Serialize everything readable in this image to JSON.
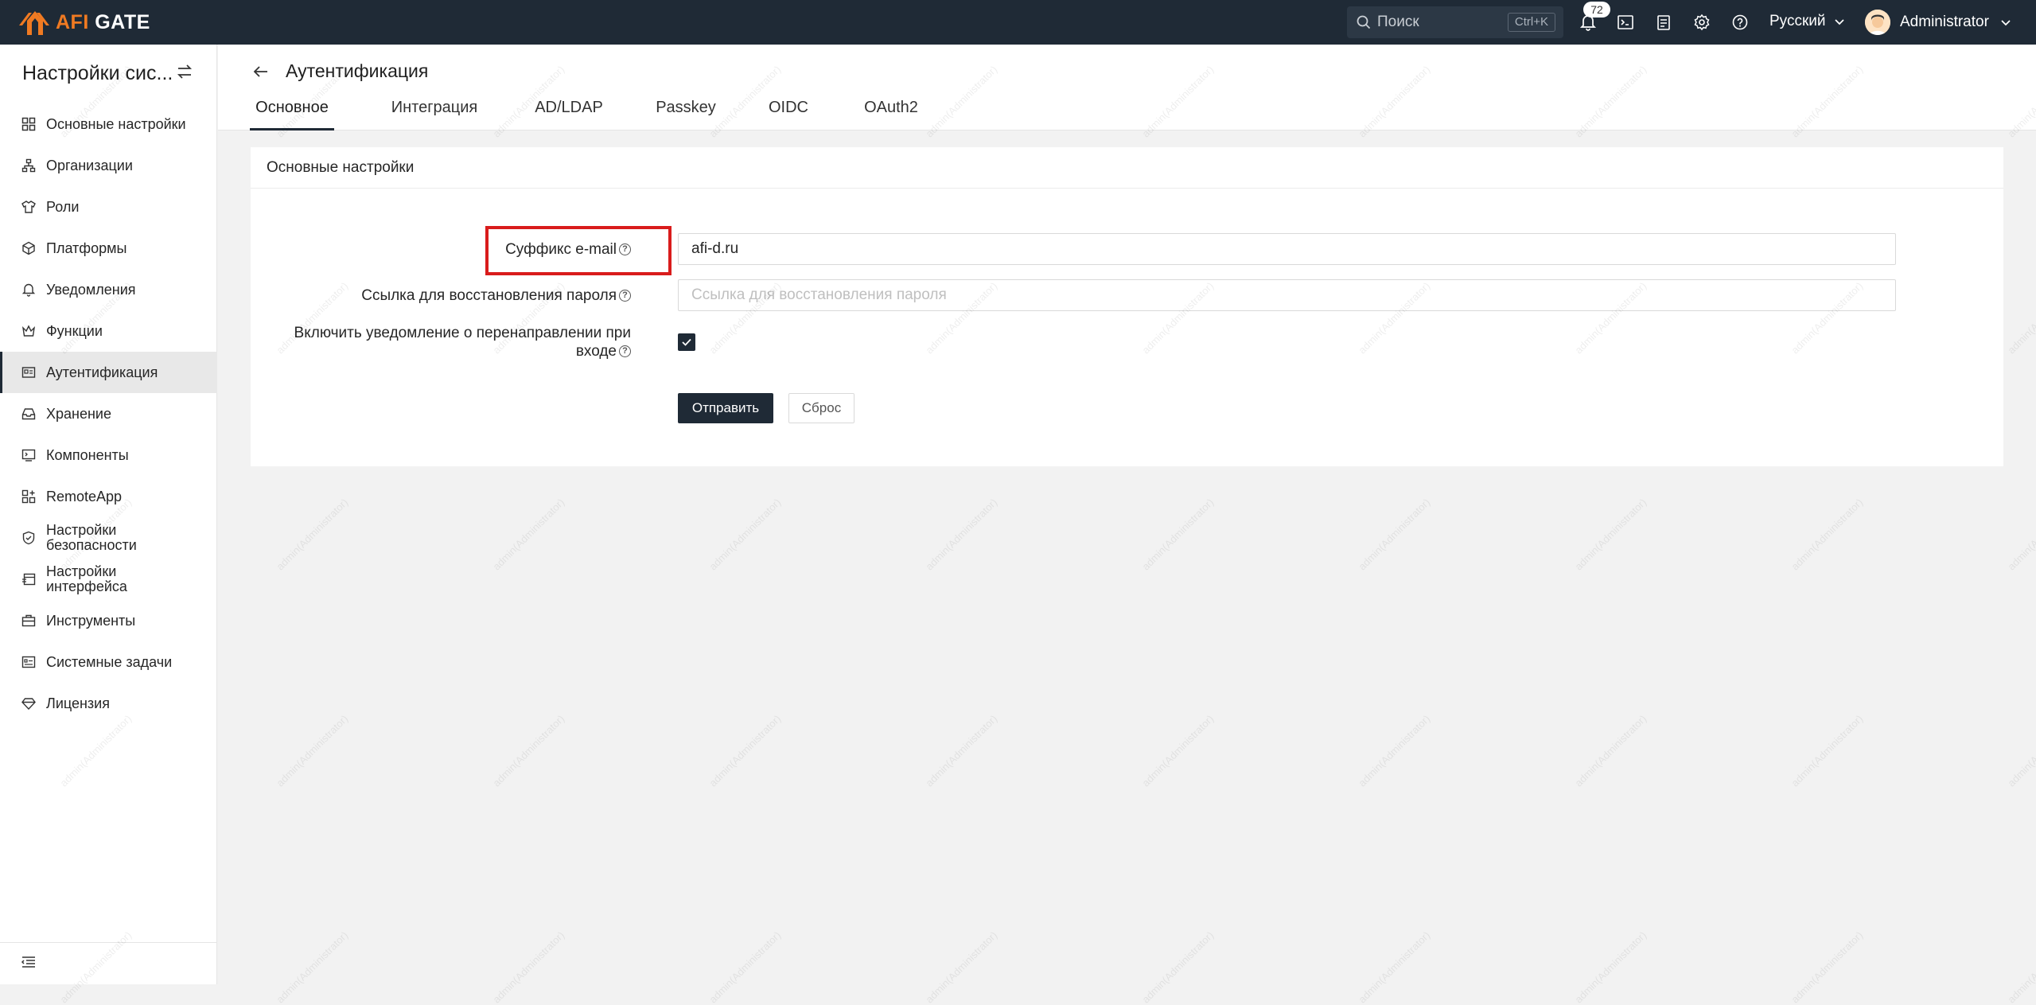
{
  "brand": {
    "name_accent": "AFI",
    "name_rest": " GATE",
    "accent_color": "#f07a22",
    "topbar_color": "#1f2a36"
  },
  "topbar": {
    "search_placeholder": "Поиск",
    "search_shortcut": "Ctrl+K",
    "notifications_count": "72",
    "language": "Русский",
    "user": "Administrator",
    "icons": [
      "bell-icon",
      "terminal-icon",
      "clipboard-icon",
      "gear-icon",
      "help-icon"
    ]
  },
  "sidebar": {
    "title": "Настройки сис...",
    "items": [
      {
        "label": "Основные настройки",
        "icon": "grid-icon"
      },
      {
        "label": "Организации",
        "icon": "org-icon"
      },
      {
        "label": "Роли",
        "icon": "shirt-icon"
      },
      {
        "label": "Платформы",
        "icon": "cube-icon"
      },
      {
        "label": "Уведомления",
        "icon": "bell-icon"
      },
      {
        "label": "Функции",
        "icon": "crown-icon"
      },
      {
        "label": "Аутентификация",
        "icon": "id-card-icon",
        "active": true
      },
      {
        "label": "Хранение",
        "icon": "inbox-icon"
      },
      {
        "label": "Компоненты",
        "icon": "console-icon"
      },
      {
        "label": "RemoteApp",
        "icon": "apps-icon"
      },
      {
        "label": "Настройки безопасности",
        "icon": "shield-icon"
      },
      {
        "label": "Настройки интерфейса",
        "icon": "layout-icon"
      },
      {
        "label": "Инструменты",
        "icon": "toolbox-icon"
      },
      {
        "label": "Системные задачи",
        "icon": "tasks-icon"
      },
      {
        "label": "Лицензия",
        "icon": "diamond-icon"
      }
    ]
  },
  "header": {
    "title": "Аутентификация",
    "tabs": [
      "Основное",
      "Интеграция",
      "AD/LDAP",
      "Passkey",
      "OIDC",
      "OAuth2"
    ]
  },
  "card": {
    "title": "Основные настройки",
    "email_suffix_label": "Суффикс e-mail",
    "email_suffix_value": "afi-d.ru",
    "reset_link_label": "Ссылка для восстановления пароля",
    "reset_link_placeholder": "Ссылка для восстановления пароля",
    "redirect_notify_label_1": "Включить уведомление о перенаправлении при",
    "redirect_notify_label_2": "входе",
    "redirect_notify_checked": true,
    "submit_label": "Отправить",
    "reset_label": "Сброс"
  },
  "watermark": "admin(Administrator)"
}
